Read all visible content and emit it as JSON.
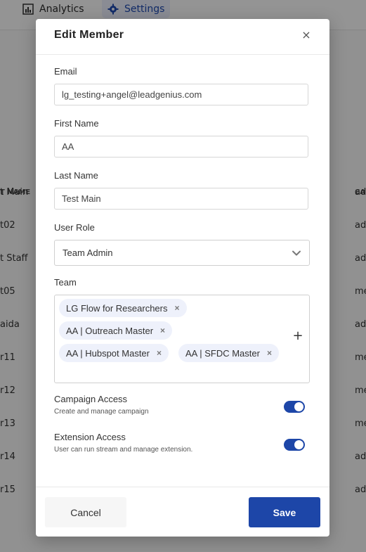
{
  "nav": {
    "analytics_label": "Analytics",
    "settings_label": "Settings"
  },
  "background_table": {
    "col_name_partial": "T NAME",
    "col_role_partial": "CA",
    "rows": [
      {
        "name": "t Main",
        "role": "ad"
      },
      {
        "name": "t02",
        "role": "ad"
      },
      {
        "name": "t Staff",
        "role": "ad"
      },
      {
        "name": "t05",
        "role": "me"
      },
      {
        "name": "aida",
        "role": "ad"
      },
      {
        "name": "r11",
        "role": "me"
      },
      {
        "name": "r12",
        "role": "me"
      },
      {
        "name": "r13",
        "role": "me"
      },
      {
        "name": "r14",
        "role": "ad"
      },
      {
        "name": "r15",
        "role": "ad"
      }
    ]
  },
  "modal": {
    "title": "Edit Member",
    "close_symbol": "×",
    "email_label": "Email",
    "email_value": "lg_testing+angel@leadgenius.com",
    "first_name_label": "First Name",
    "first_name_value": "AA",
    "last_name_label": "Last Name",
    "last_name_value": "Test Main",
    "role_label": "User Role",
    "role_value": "Team Admin",
    "team_label": "Team",
    "teams": [
      "LG Flow for Researchers",
      "AA | Outreach Master",
      "AA | Hubspot Master",
      "AA | SFDC Master"
    ],
    "chip_remove_symbol": "×",
    "add_symbol": "+",
    "campaign_access_title": "Campaign Access",
    "campaign_access_desc": "Create and manage campaign",
    "campaign_access_on": true,
    "extension_access_title": "Extension Access",
    "extension_access_desc": "User can run stream and manage extension.",
    "extension_access_on": true,
    "cancel_label": "Cancel",
    "save_label": "Save"
  },
  "colors": {
    "primary": "#1d46a8",
    "chip_bg": "#eef1fb"
  }
}
